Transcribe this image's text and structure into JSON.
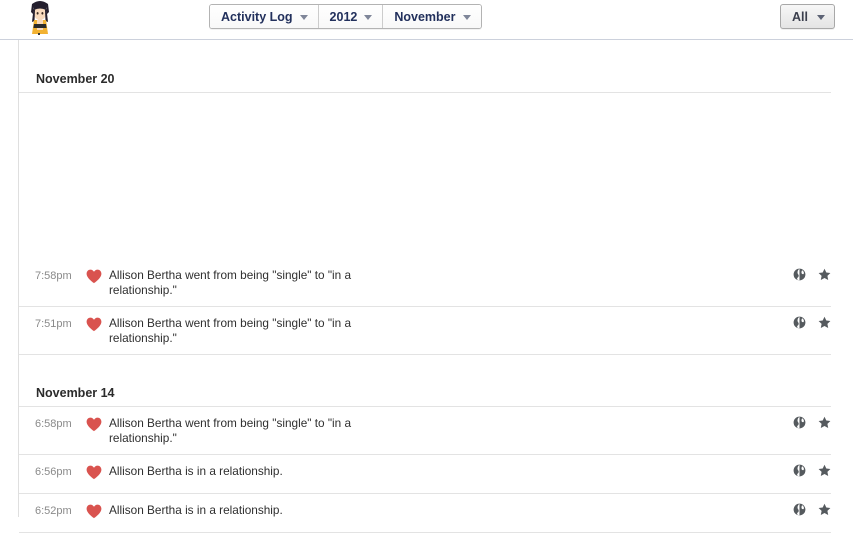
{
  "header": {
    "avatar": {
      "name": "user-avatar",
      "alt": "profile photo"
    },
    "nav": [
      {
        "label": "Activity Log",
        "icon": "chevron-down-icon"
      },
      {
        "label": "2012",
        "icon": "chevron-down-icon"
      },
      {
        "label": "November",
        "icon": "chevron-down-icon"
      }
    ],
    "filter": {
      "label": "All",
      "icon": "chevron-down-icon"
    }
  },
  "colors": {
    "heart": "#d9534f",
    "border": "#e3e3e3",
    "topbar_border": "#ccd1dc",
    "pill_text": "#22305c",
    "timestamp": "#8a8a8a",
    "icon": "#555a5e"
  },
  "sections": [
    {
      "date": "November 20",
      "entries": [
        {
          "time": "7:58pm",
          "icon": "heart-icon",
          "text": "Allison Bertha went from being \"single\" to \"in a relationship.\"",
          "privacy": "globe-icon",
          "highlight": "star-icon"
        },
        {
          "time": "7:51pm",
          "icon": "heart-icon",
          "text": "Allison Bertha went from being \"single\" to \"in a relationship.\"",
          "privacy": "globe-icon",
          "highlight": "star-icon"
        }
      ]
    },
    {
      "date": "November 14",
      "entries": [
        {
          "time": "6:58pm",
          "icon": "heart-icon",
          "text": "Allison Bertha went from being \"single\" to \"in a relationship.\"",
          "privacy": "globe-icon",
          "highlight": "star-icon"
        },
        {
          "time": "6:56pm",
          "icon": "heart-icon",
          "text": "Allison Bertha is in a relationship.",
          "privacy": "globe-icon",
          "highlight": "star-icon"
        },
        {
          "time": "6:52pm",
          "icon": "heart-icon",
          "text": "Allison Bertha is in a relationship.",
          "privacy": "globe-icon",
          "highlight": "star-icon"
        }
      ]
    }
  ]
}
